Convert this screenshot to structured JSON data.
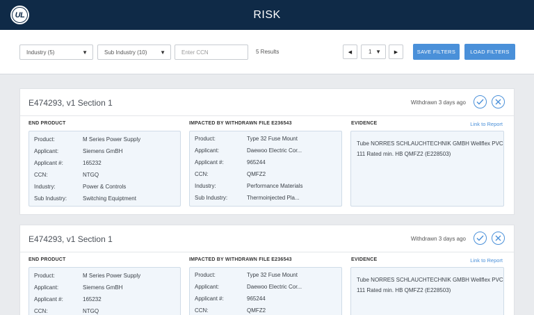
{
  "header": {
    "title": "RISK",
    "logo_text": "UL"
  },
  "filters": {
    "industry": "Industry (5)",
    "sub_industry": "Sub Industry (10)",
    "ccn_placeholder": "Enter CCN",
    "results": "5 Results",
    "page_prev": "◀",
    "page_value": "1",
    "page_next": "▶",
    "save": "SAVE FILTERS",
    "load": "LOAD FILTERS"
  },
  "cards": [
    {
      "title": "E474293, v1 Section 1",
      "status": "Withdrawn 3 days ago",
      "end_product": {
        "heading": "END PRODUCT",
        "rows": [
          {
            "k": "Product:",
            "v": "M Series Power Supply"
          },
          {
            "k": "Applicant:",
            "v": "Siemens GmBH"
          },
          {
            "k": "Applicant #:",
            "v": "165232"
          },
          {
            "k": "CCN:",
            "v": "NTGQ"
          },
          {
            "k": "Industry:",
            "v": "Power & Controls"
          },
          {
            "k": "Sub Industry:",
            "v": "Switching Equiptment"
          }
        ]
      },
      "impacted": {
        "heading": "IMPACTED BY WITHDRAWN FILE E236543",
        "rows": [
          {
            "k": "Product:",
            "v": "Type 32 Fuse Mount"
          },
          {
            "k": "Applicant:",
            "v": "Daewoo Electric Cor..."
          },
          {
            "k": "Applicant #:",
            "v": "965244"
          },
          {
            "k": "CCN:",
            "v": "QMFZ2"
          },
          {
            "k": "Industry:",
            "v": "Performance Materials"
          },
          {
            "k": "Sub Industry:",
            "v": "Thermoinjected Pla..."
          }
        ]
      },
      "evidence": {
        "heading": "EVIDENCE",
        "link": "Link to Report",
        "text": "Tube NORRES SCHLAUCHTECHNIK GMBH Wellflex PVC 111 Rated min. HB QMFZ2 (E228503)"
      }
    },
    {
      "title": "E474293, v1 Section 1",
      "status": "Withdrawn 3 days ago",
      "end_product": {
        "heading": "END PRODUCT",
        "rows": [
          {
            "k": "Product:",
            "v": "M Series Power Supply"
          },
          {
            "k": "Applicant:",
            "v": "Siemens GmBH"
          },
          {
            "k": "Applicant #:",
            "v": "165232"
          },
          {
            "k": "CCN:",
            "v": "NTGQ"
          }
        ]
      },
      "impacted": {
        "heading": "IMPACTED BY WITHDRAWN FILE E236543",
        "rows": [
          {
            "k": "Product:",
            "v": "Type 32 Fuse Mount"
          },
          {
            "k": "Applicant:",
            "v": "Daewoo Electric Cor..."
          },
          {
            "k": "Applicant #:",
            "v": "965244"
          },
          {
            "k": "CCN:",
            "v": "QMFZ2"
          }
        ]
      },
      "evidence": {
        "heading": "EVIDENCE",
        "link": "Link to Report",
        "text": "Tube NORRES SCHLAUCHTECHNIK GMBH Wellflex PVC 111 Rated min. HB QMFZ2 (E228503)"
      }
    }
  ],
  "icons": {
    "approve": "check-icon",
    "reject": "close-icon"
  },
  "colors": {
    "header_bg": "#0f2a47",
    "accent": "#4a90d9",
    "panel_bg": "#f1f6fb"
  }
}
